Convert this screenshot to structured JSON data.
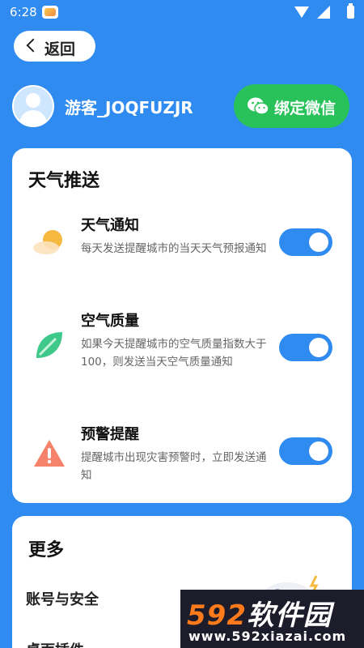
{
  "status_bar": {
    "time": "6:28",
    "icons": [
      "app-notification-icon",
      "wifi-icon",
      "signal-icon",
      "battery-icon"
    ]
  },
  "header": {
    "back_label": "返回"
  },
  "profile": {
    "username": "游客_JOQFUZJR",
    "wechat_button_label": "绑定微信"
  },
  "weather_push": {
    "title": "天气推送",
    "items": [
      {
        "title": "天气通知",
        "description": "每天发送提醒城市的当天天气预报通知",
        "enabled": true,
        "icon": "sun-cloud-icon"
      },
      {
        "title": "空气质量",
        "description": "如果今天提醒城市的空气质量指数大于100，则发送当天空气质量通知",
        "enabled": true,
        "icon": "leaf-icon"
      },
      {
        "title": "预警提醒",
        "description": "提醒城市出现灾害预警时，立即发送通知",
        "enabled": true,
        "icon": "warning-icon"
      }
    ]
  },
  "more": {
    "title": "更多",
    "items": [
      {
        "label": "账号与安全"
      },
      {
        "label": "桌面插件"
      }
    ],
    "illustration": "gamepad-icon"
  },
  "watermark": {
    "brand_num": "592",
    "brand_text": "软件园",
    "url": "www.592xiazai.com"
  },
  "colors": {
    "background": "#2f8bf0",
    "toggle_on": "#2f8bf0",
    "wechat_green": "#29c25a",
    "card": "#ffffff"
  }
}
